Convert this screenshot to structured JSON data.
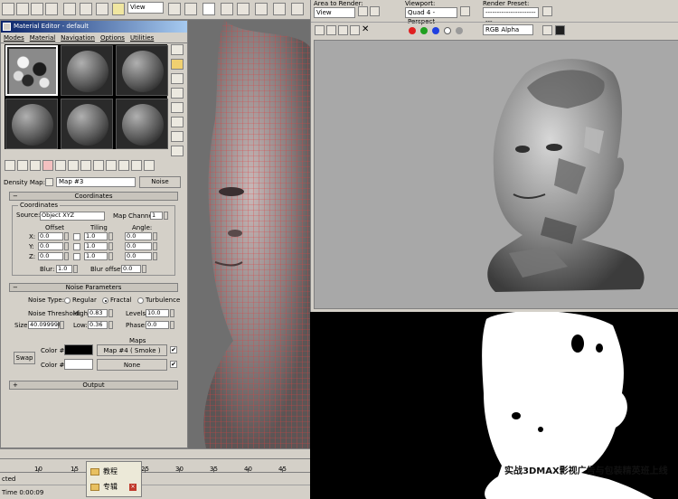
{
  "toolbar": {
    "view_combo": "View",
    "icons": [
      "select-icon",
      "region-icon",
      "move-icon",
      "rotate-icon",
      "scale-icon",
      "view-icon",
      "snap-icon",
      "angle-snap-icon",
      "percent-snap-icon",
      "spinner-snap-icon"
    ]
  },
  "material_editor": {
    "title": "Material Editor - default",
    "menu": [
      "Modes",
      "Material",
      "Navigation",
      "Options",
      "Utilities"
    ],
    "density_label": "Density Map:",
    "map_name": "Map #3",
    "map_type_button": "Noise",
    "coordinates": {
      "header": "Coordinates",
      "group_title": "Coordinates",
      "source_label": "Source:",
      "source_value": "Object XYZ",
      "map_channel_label": "Map Channel:",
      "map_channel_value": "1",
      "col_offset": "Offset",
      "col_tiling": "Tiling",
      "col_angle": "Angle:",
      "rows": [
        {
          "axis": "X:",
          "offset": "0.0",
          "tiling": "1.0",
          "angle": "0.0"
        },
        {
          "axis": "Y:",
          "offset": "0.0",
          "tiling": "1.0",
          "angle": "0.0"
        },
        {
          "axis": "Z:",
          "offset": "0.0",
          "tiling": "1.0",
          "angle": "0.0"
        }
      ],
      "blur_label": "Blur:",
      "blur_value": "1.0",
      "blur_offset_label": "Blur offset:",
      "blur_offset_value": "0.0"
    },
    "noise": {
      "header": "Noise Parameters",
      "type_label": "Noise Type:",
      "types": [
        "Regular",
        "Fractal",
        "Turbulence"
      ],
      "selected_type": "Fractal",
      "threshold_label": "Noise Threshold:",
      "high_label": "High:",
      "high_value": "0.83",
      "levels_label": "Levels:",
      "levels_value": "10.0",
      "size_label": "Size:",
      "size_value": "40.099998",
      "low_label": "Low:",
      "low_value": "0.36",
      "phase_label": "Phase:",
      "phase_value": "0.0",
      "maps_label": "Maps",
      "swap_button": "Swap",
      "color1_label": "Color #1",
      "color1": "#000000",
      "color1_map": "Map #4  ( Smoke )",
      "color2_label": "Color #2",
      "color2": "#ffffff",
      "color2_map": "None",
      "check_mark": "✔"
    },
    "output_header": "Output"
  },
  "timeline": {
    "ticks": [
      "10",
      "15",
      "20",
      "25",
      "30",
      "35",
      "40",
      "45"
    ],
    "status_text": "cted",
    "time_label": "Time  0:00:09"
  },
  "taskbar_popup": {
    "items": [
      "教程",
      "专辑"
    ]
  },
  "render_panel": {
    "area_label": "Area to Render:",
    "area_value": "View",
    "viewport_label": "Viewport:",
    "viewport_value": "Quad 4 - Perspect",
    "preset_label": "Render Preset:",
    "preset_value": "-------------------------",
    "channel_value": "RGB Alpha"
  },
  "watermark": "实战3DMAX影视广告与包装精英班上线"
}
